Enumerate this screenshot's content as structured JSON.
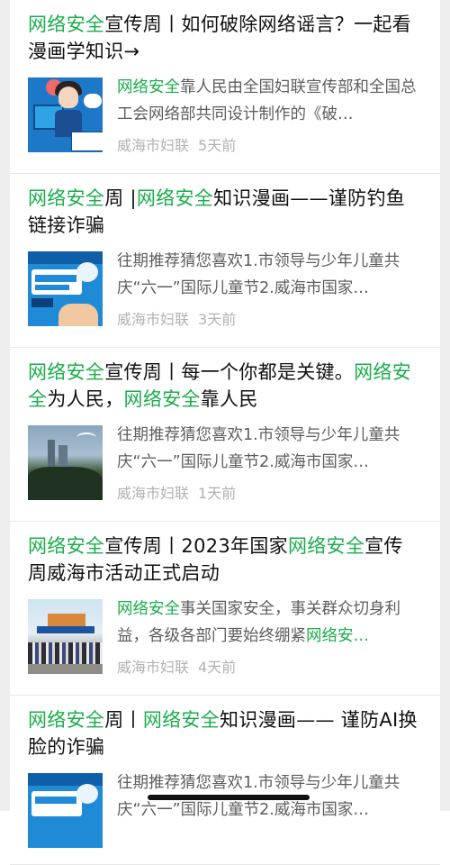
{
  "articles": [
    {
      "title_parts": [
        {
          "text": "网络安全",
          "hl": true
        },
        {
          "text": "宣传周丨如何破除网络谣言？一起看漫画学知识→",
          "hl": false
        }
      ],
      "desc_parts": [
        {
          "text": "网络安全",
          "hl": true
        },
        {
          "text": "靠人民由全国妇联宣传部和全国总工会网络部共同设计制作的《破…",
          "hl": false
        }
      ],
      "source": "威海市妇联",
      "time": "5天前",
      "thumb_icon": "cartoon-teacher-thumbnail"
    },
    {
      "title_parts": [
        {
          "text": "网络安全",
          "hl": true
        },
        {
          "text": "周 |",
          "hl": false
        },
        {
          "text": "网络安全",
          "hl": true
        },
        {
          "text": "知识漫画——谨防钓鱼链接诈骗",
          "hl": false
        }
      ],
      "desc_parts": [
        {
          "text": "往期推荐猜您喜欢1.市领导与少年儿童共庆“六一”国际儿童节2.威海市国家…",
          "hl": false
        }
      ],
      "source": "威海市妇联",
      "time": "3天前",
      "thumb_icon": "phishing-comic-thumbnail"
    },
    {
      "title_parts": [
        {
          "text": "网络安全",
          "hl": true
        },
        {
          "text": "宣传周丨每一个你都是关键。",
          "hl": false
        },
        {
          "text": "网络安全",
          "hl": true
        },
        {
          "text": "为人民，",
          "hl": false
        },
        {
          "text": "网络安全",
          "hl": true
        },
        {
          "text": "靠人民",
          "hl": false
        }
      ],
      "desc_parts": [
        {
          "text": "往期推荐猜您喜欢1.市领导与少年儿童共庆“六一”国际儿童节2.威海市国家…",
          "hl": false
        }
      ],
      "source": "威海市妇联",
      "time": "1天前",
      "thumb_icon": "city-skyline-thumbnail"
    },
    {
      "title_parts": [
        {
          "text": "网络安全",
          "hl": true
        },
        {
          "text": "宣传周丨2023年国家",
          "hl": false
        },
        {
          "text": "网络安全",
          "hl": true
        },
        {
          "text": "宣传周威海市活动正式启动",
          "hl": false
        }
      ],
      "desc_parts": [
        {
          "text": "网络安全",
          "hl": true
        },
        {
          "text": "事关国家安全，事关群众切身利益，各级各部门要始终绷紧",
          "hl": false
        },
        {
          "text": "网络安…",
          "hl": true
        }
      ],
      "source": "威海市妇联",
      "time": "4天前",
      "thumb_icon": "launch-ceremony-thumbnail"
    },
    {
      "title_parts": [
        {
          "text": "网络安全",
          "hl": true
        },
        {
          "text": "周丨",
          "hl": false
        },
        {
          "text": "网络安全",
          "hl": true
        },
        {
          "text": "知识漫画—— 谨防AI换脸的诈骗",
          "hl": false
        }
      ],
      "desc_parts": [
        {
          "text": "往期推荐猜您喜欢1.市领导与少年儿童共庆“六一”国际儿童节2.威海市国家…",
          "hl": false
        }
      ],
      "source": "",
      "time": "",
      "thumb_icon": "ai-faceswap-comic-thumbnail"
    }
  ],
  "colors": {
    "highlight": "#1aad4b",
    "title_text": "#111111",
    "desc_text": "#5d5d5d",
    "meta_text": "#b2b2b2"
  }
}
